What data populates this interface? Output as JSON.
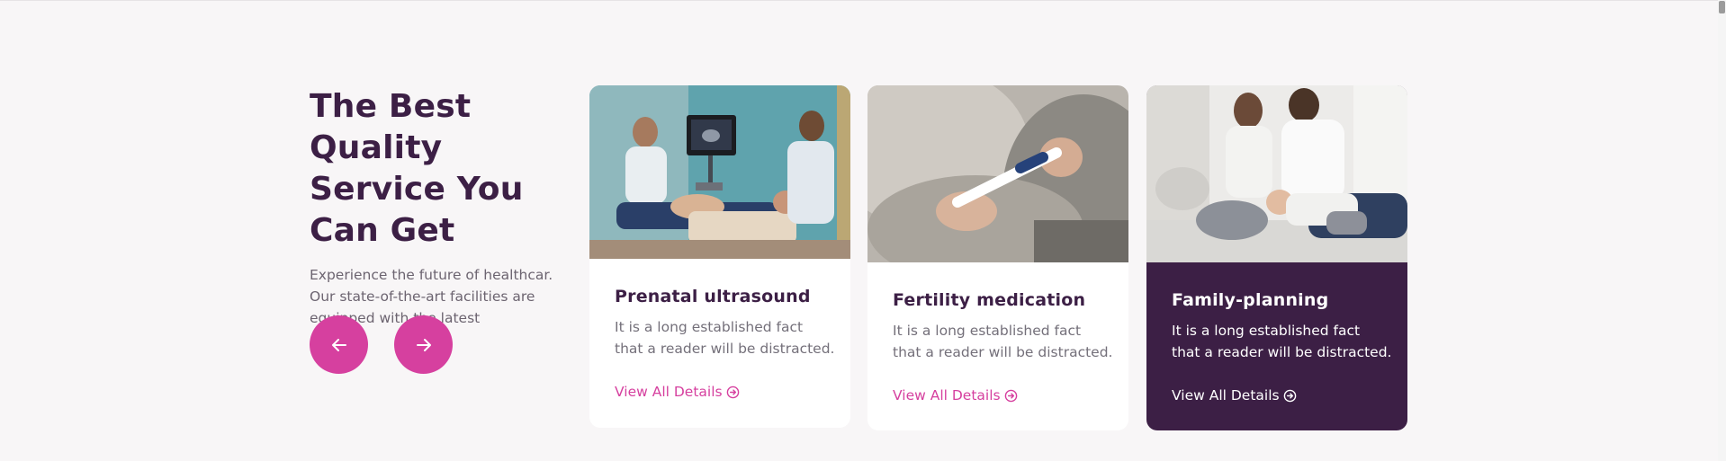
{
  "section": {
    "heading": "The Best Quality Service You Can Get",
    "description": "Experience the future of healthcar. Our state-of-the-art facilities are equipped with the latest"
  },
  "nav": {
    "prev_icon": "arrow-left-icon",
    "next_icon": "arrow-right-icon"
  },
  "cards": [
    {
      "title": "Prenatal ultrasound",
      "text": "It is a long established fact that a reader will be distracted.",
      "link": "View All Details",
      "image": "ultrasound-scan-photo"
    },
    {
      "title": "Fertility medication",
      "text": "It is a long established fact that a reader will be distracted.",
      "link": "View All Details",
      "image": "pregnancy-test-photo"
    },
    {
      "title": "Family-planning",
      "text": "It is a long established fact that a reader will be distracted.",
      "link": "View All Details",
      "image": "family-photo"
    }
  ],
  "colors": {
    "accent": "#d6409f",
    "brand_dark": "#3c1f45",
    "background": "#f8f6f7"
  }
}
